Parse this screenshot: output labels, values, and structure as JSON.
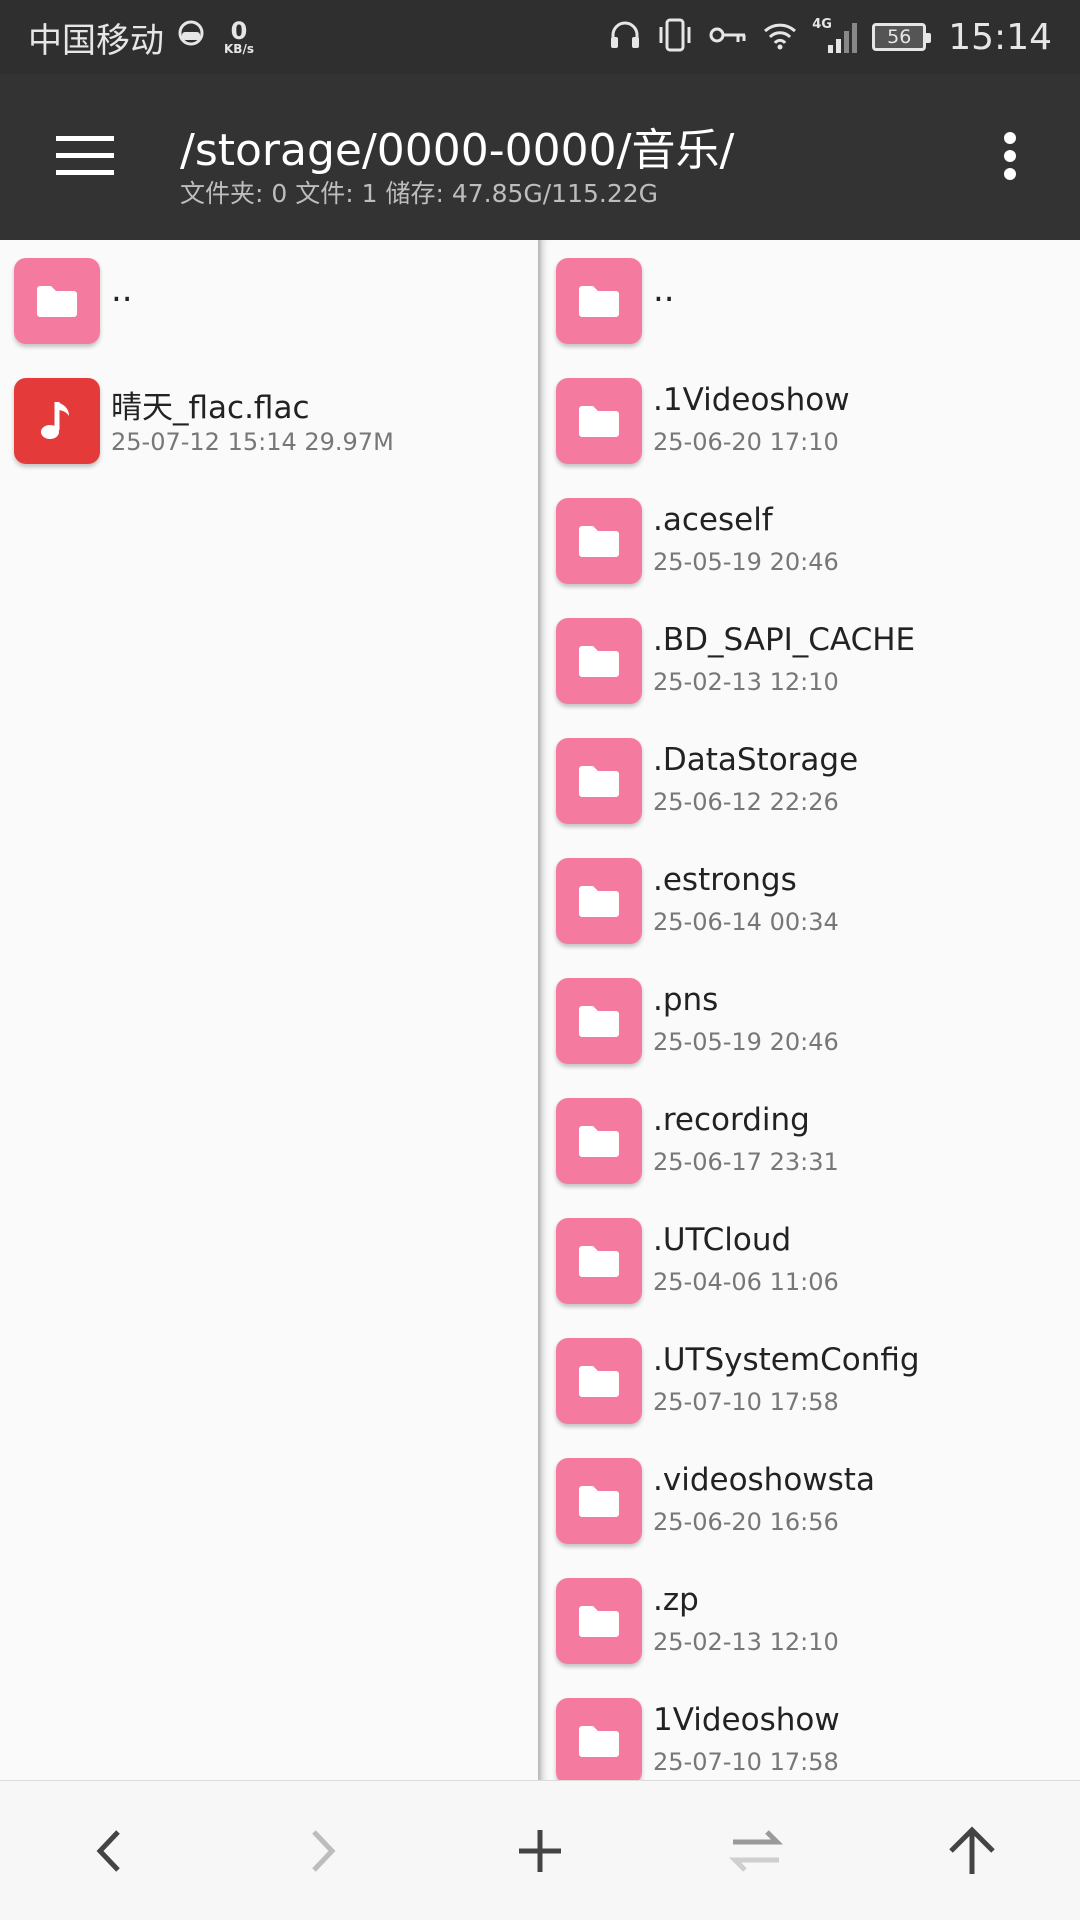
{
  "status_bar": {
    "carrier": "中国移动",
    "net_speed_value": "0",
    "net_speed_unit": "KB/s",
    "network_type": "4G",
    "battery": "56",
    "time": "15:14"
  },
  "toolbar": {
    "path": "/storage/0000-0000/音乐/",
    "info": "文件夹: 0  文件: 1  储存: 47.85G/115.22G"
  },
  "left_pane": {
    "items": [
      {
        "name": "..",
        "meta": "",
        "type": "folder"
      },
      {
        "name": "晴天_flac.flac",
        "meta": "25-07-12 15:14   29.97M",
        "type": "music"
      }
    ]
  },
  "right_pane": {
    "items": [
      {
        "name": "..",
        "meta": "",
        "type": "folder"
      },
      {
        "name": ".1Videoshow",
        "meta": "25-06-20 17:10",
        "type": "folder"
      },
      {
        "name": ".aceself",
        "meta": "25-05-19 20:46",
        "type": "folder"
      },
      {
        "name": ".BD_SAPI_CACHE",
        "meta": "25-02-13 12:10",
        "type": "folder"
      },
      {
        "name": ".DataStorage",
        "meta": "25-06-12 22:26",
        "type": "folder"
      },
      {
        "name": ".estrongs",
        "meta": "25-06-14 00:34",
        "type": "folder"
      },
      {
        "name": ".pns",
        "meta": "25-05-19 20:46",
        "type": "folder"
      },
      {
        "name": ".recording",
        "meta": "25-06-17 23:31",
        "type": "folder"
      },
      {
        "name": ".UTCloud",
        "meta": "25-04-06 11:06",
        "type": "folder"
      },
      {
        "name": ".UTSystemConfig",
        "meta": "25-07-10 17:58",
        "type": "folder"
      },
      {
        "name": ".videoshowsta",
        "meta": "25-06-20 16:56",
        "type": "folder"
      },
      {
        "name": ".zp",
        "meta": "25-02-13 12:10",
        "type": "folder"
      },
      {
        "name": "1Videoshow",
        "meta": "25-07-10 17:58",
        "type": "folder"
      }
    ]
  },
  "bottom_bar": {
    "icons": [
      "back-arrow-icon",
      "forward-arrow-icon",
      "plus-icon",
      "swap-icon",
      "up-arrow-icon"
    ]
  },
  "colors": {
    "toolbar": "#333333",
    "folder_icon": "#f57aa0",
    "music_icon": "#e53a3a"
  }
}
